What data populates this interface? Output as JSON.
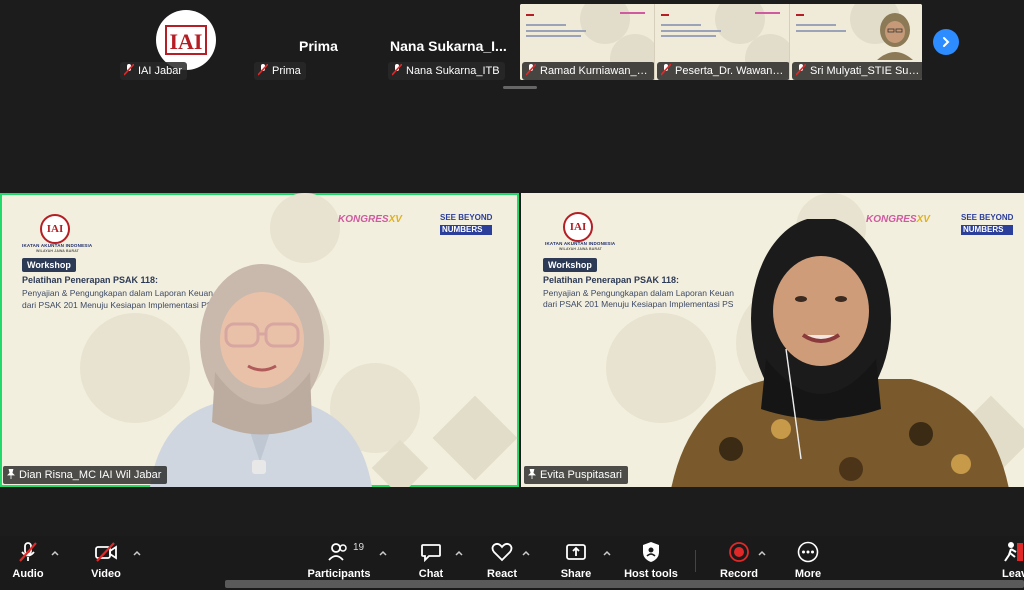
{
  "strip": {
    "tiles": [
      {
        "big_label": "",
        "chip": "IAI Jabar"
      },
      {
        "big_label": "Prima",
        "chip": "Prima"
      },
      {
        "big_label": "Nana  Sukarna_I...",
        "chip": "Nana Sukarna_ITB"
      }
    ],
    "video_chips": [
      "Ramad Kurniawan_Pusr",
      "Peserta_Dr. Wawan Su...",
      "Sri Mulyati_STIE Sutaat..."
    ],
    "logo_text": "IAI"
  },
  "slide": {
    "org_name": "IKATAN AKUNTAN INDONESIA",
    "org_sub": "WILAYAH JAWA BARAT",
    "workshop": "Workshop",
    "title": "Pelatihan Penerapan PSAK 118:",
    "sub1": "Penyajian & Pengungkapan dalam Laporan Keuan",
    "sub2": "dari PSAK 201 Menuju Kesiapan Implementasi PSA",
    "sub2_right": "dari PSAK 201 Menuju Kesiapan Implementasi PS",
    "see_beyond": "SEE BEYOND",
    "numbers": "NUMBERS",
    "kongres": "KONGRES",
    "roman": "XV"
  },
  "tiles": {
    "left_name": "Dian Risna_MC IAI Wil Jabar",
    "right_name": "Evita Puspitasari"
  },
  "toolbar": {
    "audio": "Audio",
    "video": "Video",
    "participants": "Participants",
    "participants_count": "19",
    "chat": "Chat",
    "react": "React",
    "share": "Share",
    "host_tools": "Host tools",
    "record": "Record",
    "more": "More",
    "leave": "Leave"
  },
  "colors": {
    "active_speaker": "#23d96b",
    "accent": "#2d8cff",
    "mute_red": "#e02828"
  }
}
